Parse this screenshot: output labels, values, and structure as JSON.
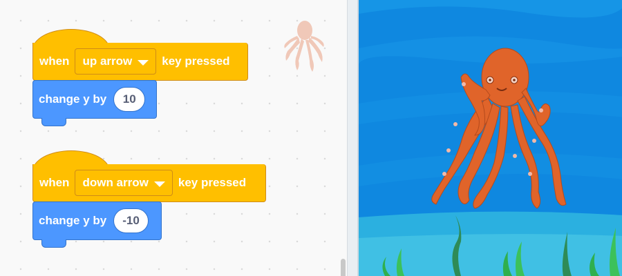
{
  "scripts": [
    {
      "hat_when": "when",
      "key_option": "up arrow",
      "hat_suffix": "key pressed",
      "motion_label": "change y by",
      "motion_value": "10"
    },
    {
      "hat_when": "when",
      "key_option": "down arrow",
      "hat_suffix": "key pressed",
      "motion_label": "change y by",
      "motion_value": "-10"
    }
  ],
  "sprite": {
    "name_icon": "octopus-sprite"
  },
  "colors": {
    "events": "#ffbf00",
    "motion": "#4c97ff",
    "stage_water": "#0f88e0",
    "octopus": "#e0642a"
  }
}
